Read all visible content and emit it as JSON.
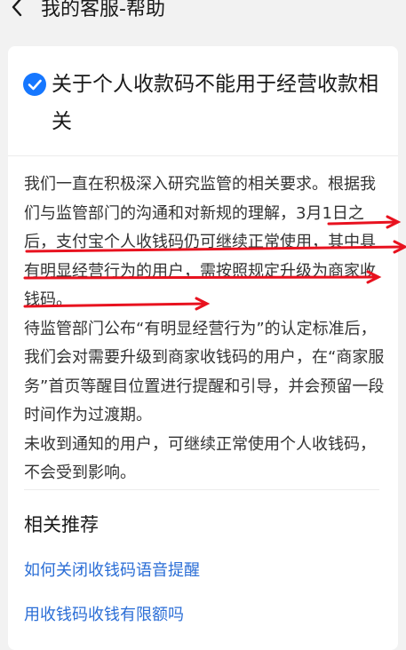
{
  "nav": {
    "title": "我的客服-帮助"
  },
  "article": {
    "title": "关于个人收款码不能用于经营收款相关",
    "paragraphs": [
      "我们一直在积极深入研究监管的相关要求。根据我们与监管部门的沟通和对新规的理解，3月1日之后，支付宝个人收钱码仍可继续正常使用，其中具有明显经营行为的用户，需按照规定升级为商家收钱码。",
      "待监管部门公布“有明显经营行为”的认定标准后，我们会对需要升级到商家收钱码的用户，在“商家服务”首页等醒目位置进行提醒和引导，并会预留一段时间作为过渡期。",
      "未收到通知的用户，可继续正常使用个人收钱码，不会受到影响。"
    ]
  },
  "recommend": {
    "title": "相关推荐",
    "items": [
      {
        "label": "如何关闭收钱码语音提醒"
      },
      {
        "label": "用收钱码收钱有限额吗"
      }
    ]
  },
  "colors": {
    "accent": "#1677ff",
    "link": "#2b6ed6",
    "annotation": "#e8121f",
    "page_bg": "#f2f2f2",
    "card_bg": "#ffffff"
  },
  "icons": {
    "back": "chevron-left-icon",
    "verified": "check-circle-icon"
  }
}
